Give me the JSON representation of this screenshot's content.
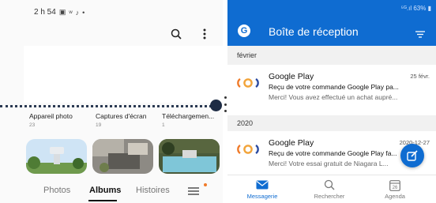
{
  "left_pane": {
    "status": {
      "time": "2 h 54",
      "icons": [
        "gallery-icon",
        "w-icon",
        "tiktok-icon",
        "dot-icon"
      ]
    },
    "albums": [
      {
        "name": "Appareil photo",
        "count": "23"
      },
      {
        "name": "Captures d'écran",
        "count": "19"
      },
      {
        "name": "Téléchargemen...",
        "count": "1"
      }
    ],
    "bottom_nav": {
      "photos": "Photos",
      "albums": "Albums",
      "stories": "Histoires"
    }
  },
  "right_pane": {
    "status": {
      "text": "⁵ᴳ.ıl 63% ▮"
    },
    "header": {
      "avatar_letter": "G",
      "title": "Boîte de réception"
    },
    "sections": [
      {
        "label": "février",
        "mails": [
          {
            "sender": "Google Play",
            "date": "25 févr.",
            "subject": "Reçu de votre commande Google Play pa...",
            "preview": "Merci! Vous avez effectué un achat aupré..."
          }
        ]
      },
      {
        "label": "2020",
        "mails": [
          {
            "sender": "Google Play",
            "date": "2020-12-27",
            "subject": "Reçu de votre commande Google Play fa...",
            "preview": "Merci! Votre essai gratuit de Niagara L..."
          }
        ]
      }
    ],
    "tabs": {
      "mail": "Messagerie",
      "search": "Rechercher",
      "calendar": "Agenda",
      "calendar_day": "26"
    }
  },
  "colors": {
    "outlook_blue": "#0f6cd1",
    "handle_navy": "#1d2b44",
    "notification_orange": "#f07b2a"
  }
}
